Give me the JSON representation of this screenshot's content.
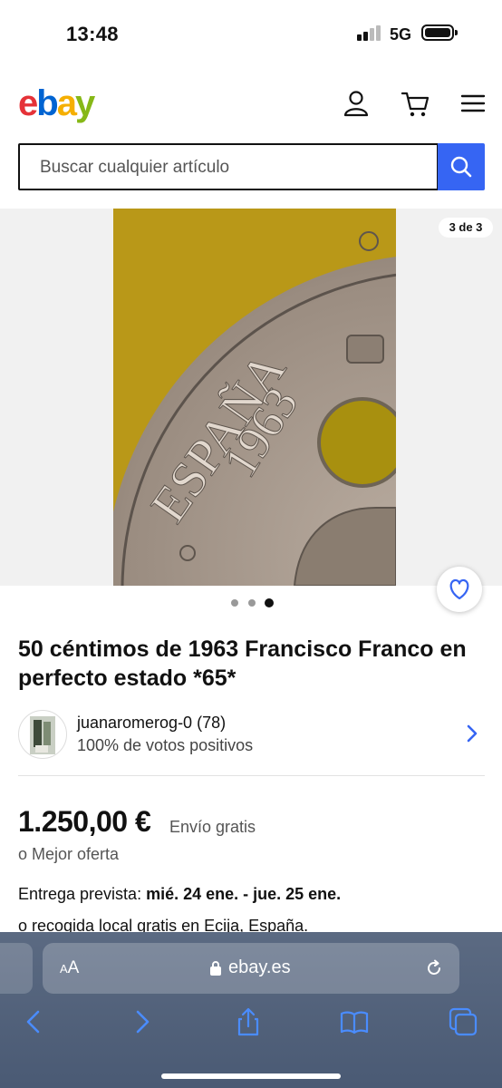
{
  "status_bar": {
    "time": "13:48",
    "network": "5G"
  },
  "header": {
    "logo_letters": [
      {
        "char": "e",
        "color": "#e53238"
      },
      {
        "char": "b",
        "color": "#0064d2"
      },
      {
        "char": "a",
        "color": "#f5af02"
      },
      {
        "char": "y",
        "color": "#86b817"
      }
    ],
    "icons": [
      "user-icon",
      "cart-icon",
      "menu-icon"
    ]
  },
  "search": {
    "placeholder": "Buscar cualquier artículo",
    "button_icon": "search-icon"
  },
  "gallery": {
    "counter": "3 de 3",
    "coin_text": "ESPAÑA",
    "coin_year": "1963",
    "current_dot": 3,
    "total_dots": 3
  },
  "listing": {
    "title": "50 céntimos de 1963 Francisco Franco en perfecto estado *65*",
    "seller": {
      "name": "juanaromerog-0 (78)",
      "rating": "100% de votos positivos"
    },
    "price": "1.250,00 €",
    "shipping": "Envío gratis",
    "offer": "o Mejor oferta",
    "delivery_label": "Entrega prevista: ",
    "delivery_dates": "mié. 24 ene. - jue. 25 ene.",
    "pickup": "o recogida local gratis en Ecija, España."
  },
  "browser": {
    "aa_label": "AA",
    "url": "ebay.es",
    "toolbar": [
      "back-icon",
      "forward-icon",
      "share-icon",
      "bookmarks-icon",
      "tabs-icon"
    ]
  },
  "colors": {
    "accent": "#3665f3",
    "browser_bar": "#4f5f78"
  }
}
